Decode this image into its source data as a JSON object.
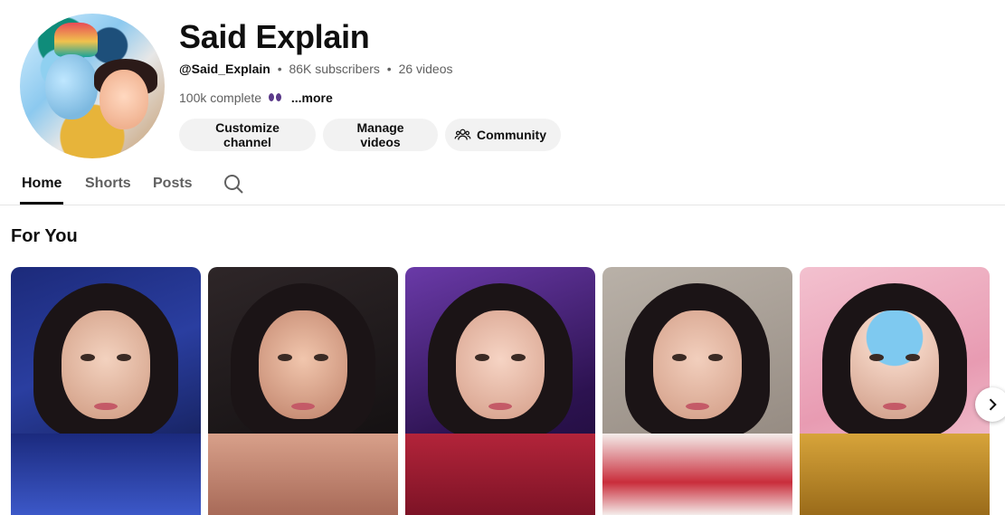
{
  "channel": {
    "name": "Said Explain",
    "handle": "@Said_Explain",
    "subscribers": "86K subscribers",
    "videos": "26 videos",
    "description": "100k complete",
    "description_emoji": "eyes-emoji",
    "more_label": "...more"
  },
  "actions": {
    "customize_label": "Customize channel",
    "manage_label": "Manage videos",
    "community_label": "Community"
  },
  "tabs": [
    {
      "label": "Home",
      "selected": true
    },
    {
      "label": "Shorts",
      "selected": false
    },
    {
      "label": "Posts",
      "selected": false
    }
  ],
  "section": {
    "title": "For You"
  },
  "icons": {
    "community": "people-icon",
    "search": "search-icon",
    "next": "chevron-right-icon"
  },
  "colors": {
    "button_bg": "#f2f2f2",
    "text_primary": "#0f0f0f",
    "text_secondary": "#606060"
  }
}
